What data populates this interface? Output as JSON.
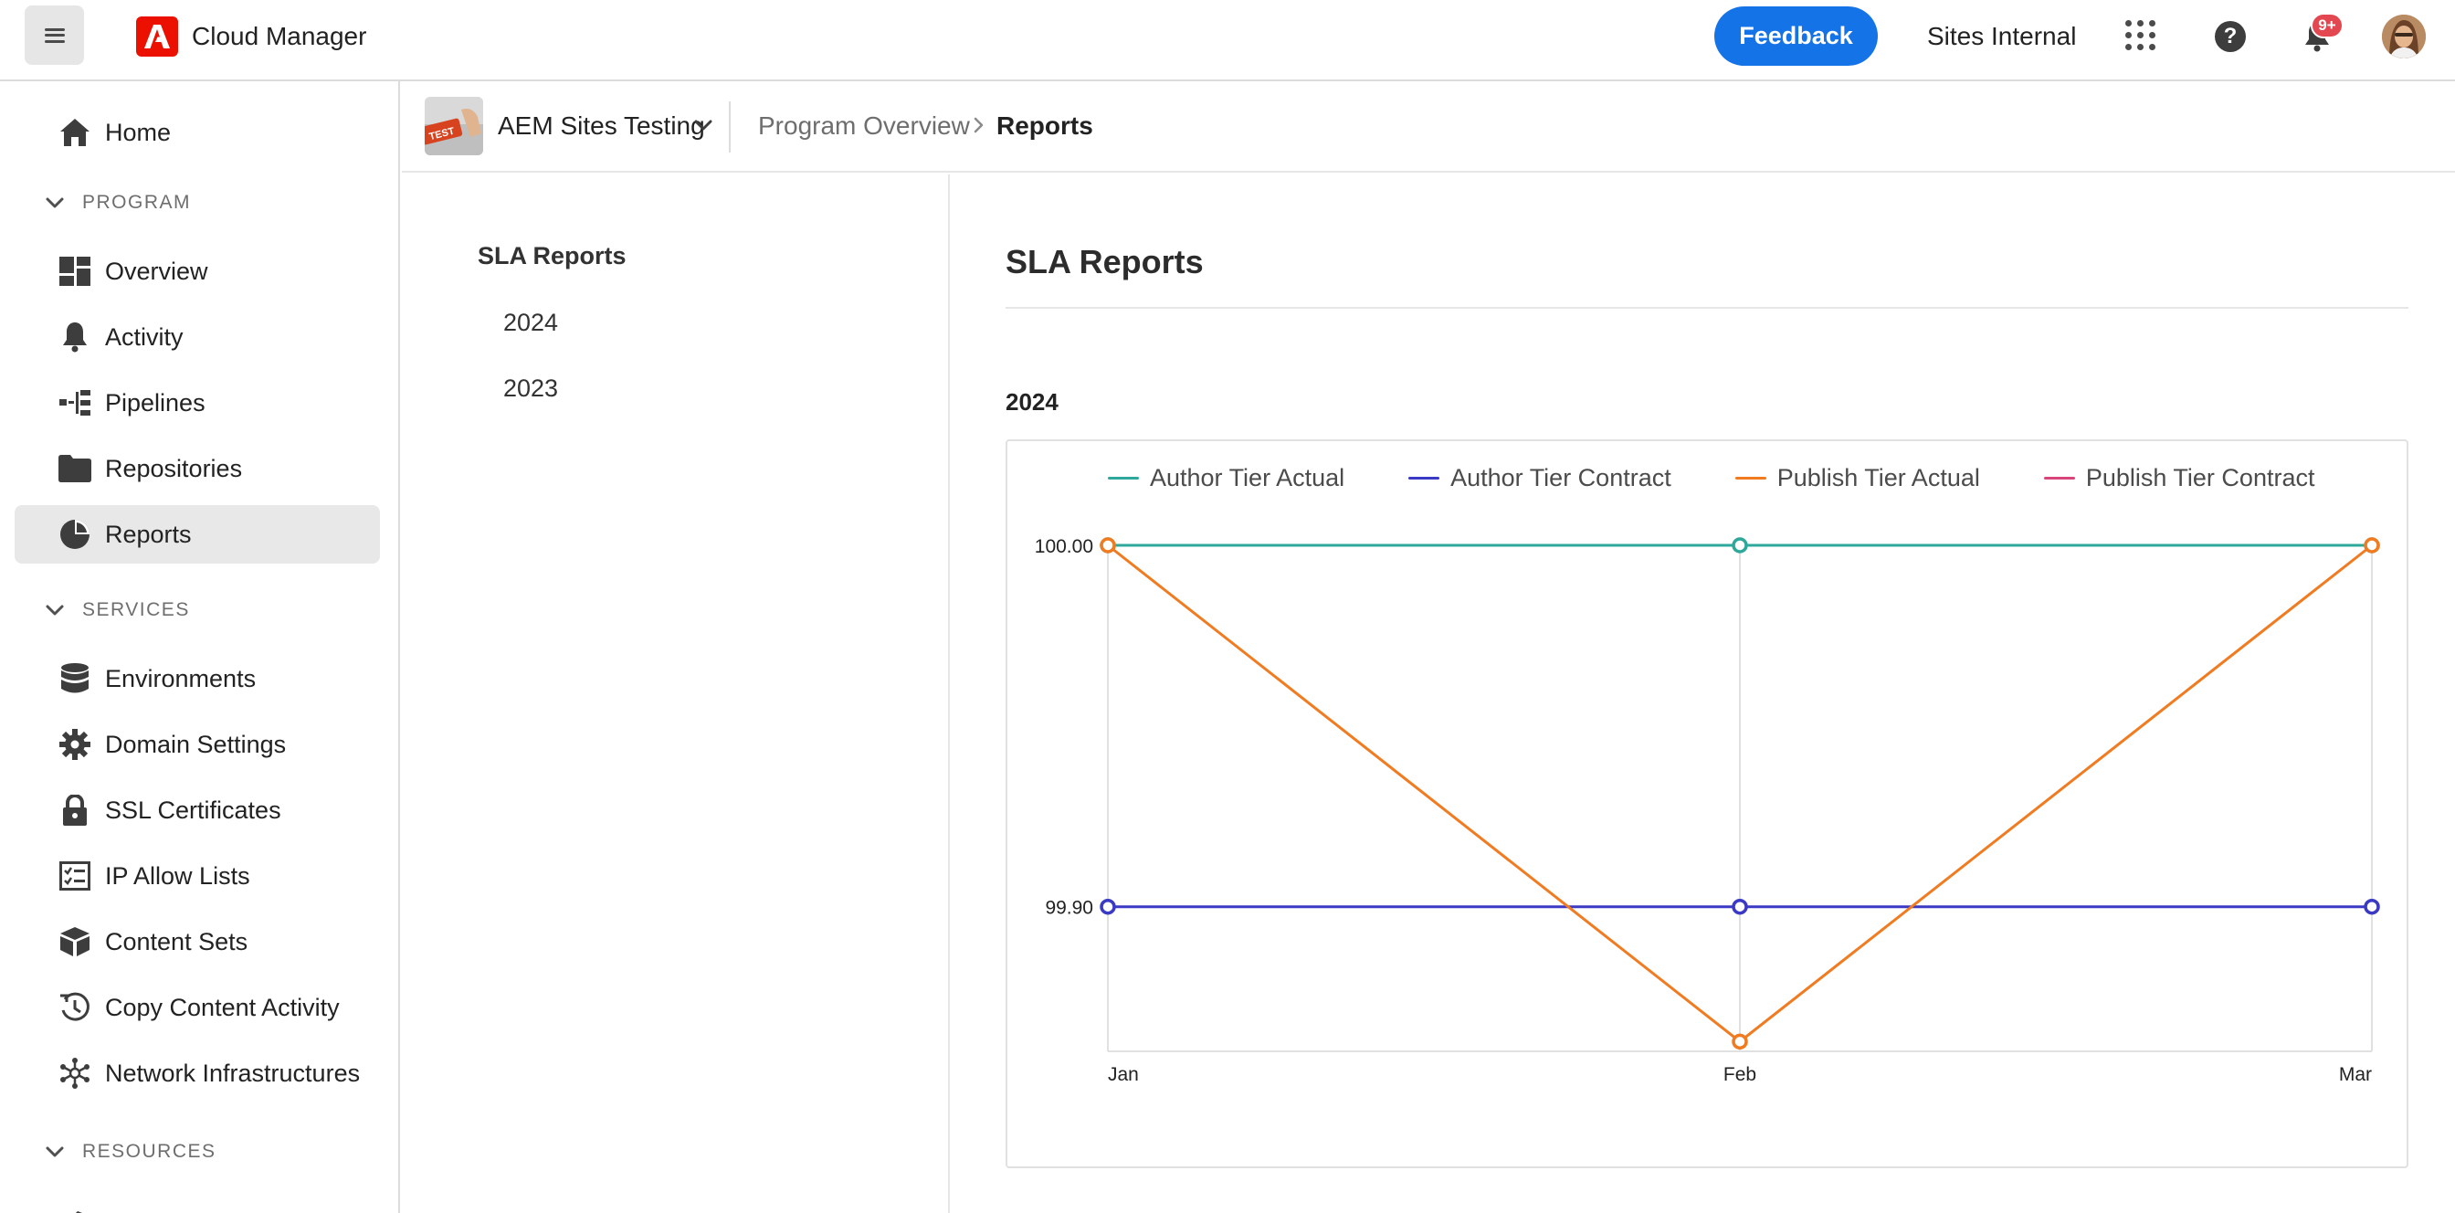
{
  "header": {
    "app_title": "Cloud Manager",
    "feedback_label": "Feedback",
    "org_name": "Sites Internal",
    "notification_count": "9+"
  },
  "sidebar": {
    "home": "Home",
    "program_section": "PROGRAM",
    "program_items": [
      "Overview",
      "Activity",
      "Pipelines",
      "Repositories",
      "Reports"
    ],
    "services_section": "SERVICES",
    "services_items": [
      "Environments",
      "Domain Settings",
      "SSL Certificates",
      "IP Allow Lists",
      "Content Sets",
      "Copy Content Activity",
      "Network Infrastructures"
    ],
    "resources_section": "RESOURCES",
    "active_item": "Reports"
  },
  "breadcrumb": {
    "program_name": "AEM Sites Testing",
    "thumb_label": "TEST",
    "crumbs": [
      "Program Overview",
      "Reports"
    ]
  },
  "subnav": {
    "title": "SLA Reports",
    "items": [
      "2024",
      "2023"
    ]
  },
  "main": {
    "title": "SLA Reports",
    "year_heading": "2024"
  },
  "colors": {
    "accent": "#1473e6",
    "author_actual": "#2da89b",
    "author_contract": "#3a3ac4",
    "publish_actual": "#f07b20",
    "publish_contract": "#d8457a"
  },
  "chart_data": {
    "type": "line",
    "categories": [
      "Jan",
      "Feb",
      "Mar"
    ],
    "ylim": [
      99.86,
      100.0
    ],
    "yticks": [
      {
        "value": 100.0,
        "label": "100.00"
      },
      {
        "value": 99.9,
        "label": "99.90"
      }
    ],
    "series": [
      {
        "name": "Author Tier Actual",
        "color": "#2da89b",
        "values": [
          100.0,
          100.0,
          100.0
        ]
      },
      {
        "name": "Author Tier Contract",
        "color": "#3a3ac4",
        "values": [
          99.9,
          99.9,
          99.9
        ]
      },
      {
        "name": "Publish Tier Actual",
        "color": "#f07b20",
        "values": [
          100.0,
          99.8627,
          100.0
        ]
      },
      {
        "name": "Publish Tier Contract",
        "color": "#d8457a",
        "values": []
      }
    ],
    "legend_position": "top",
    "grid": true
  }
}
